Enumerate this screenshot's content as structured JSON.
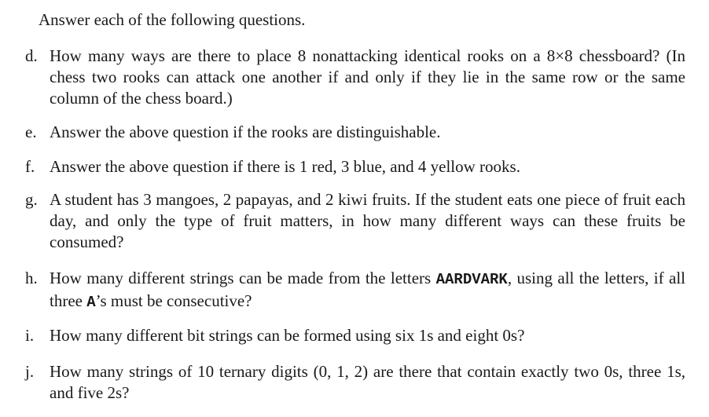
{
  "intro": "Answer each of the following questions.",
  "questions": {
    "d": {
      "label": "d.",
      "text": "How many ways are there to place 8 nonattacking identical rooks on a 8×8 chessboard? (In chess two rooks can attack one another if and only if they lie in the same row or the same column of the chess board.)"
    },
    "e": {
      "label": "e.",
      "text": "Answer the above question if the rooks are distinguishable."
    },
    "f": {
      "label": "f.",
      "text": "Answer the above question if there is 1 red, 3 blue, and 4 yellow rooks."
    },
    "g": {
      "label": "g.",
      "text": "A student has 3 mangoes, 2 papayas, and 2 kiwi fruits. If the student eats one piece of fruit each day, and only the type of fruit matters, in how many different ways can these fruits be consumed?"
    },
    "h": {
      "label": "h.",
      "text_before": "How many different strings can be made from the letters ",
      "word": "AARDVARK",
      "text_middle": ", using all the letters, if all three ",
      "letter": "A",
      "text_after": "’s must be consecutive?"
    },
    "i": {
      "label": "i.",
      "text": "How many different bit strings can be formed using six 1s and eight 0s?"
    },
    "j": {
      "label": "j.",
      "text": "How many strings of 10 ternary digits (0, 1, 2) are there that contain exactly two 0s, three 1s, and five 2s?"
    }
  }
}
